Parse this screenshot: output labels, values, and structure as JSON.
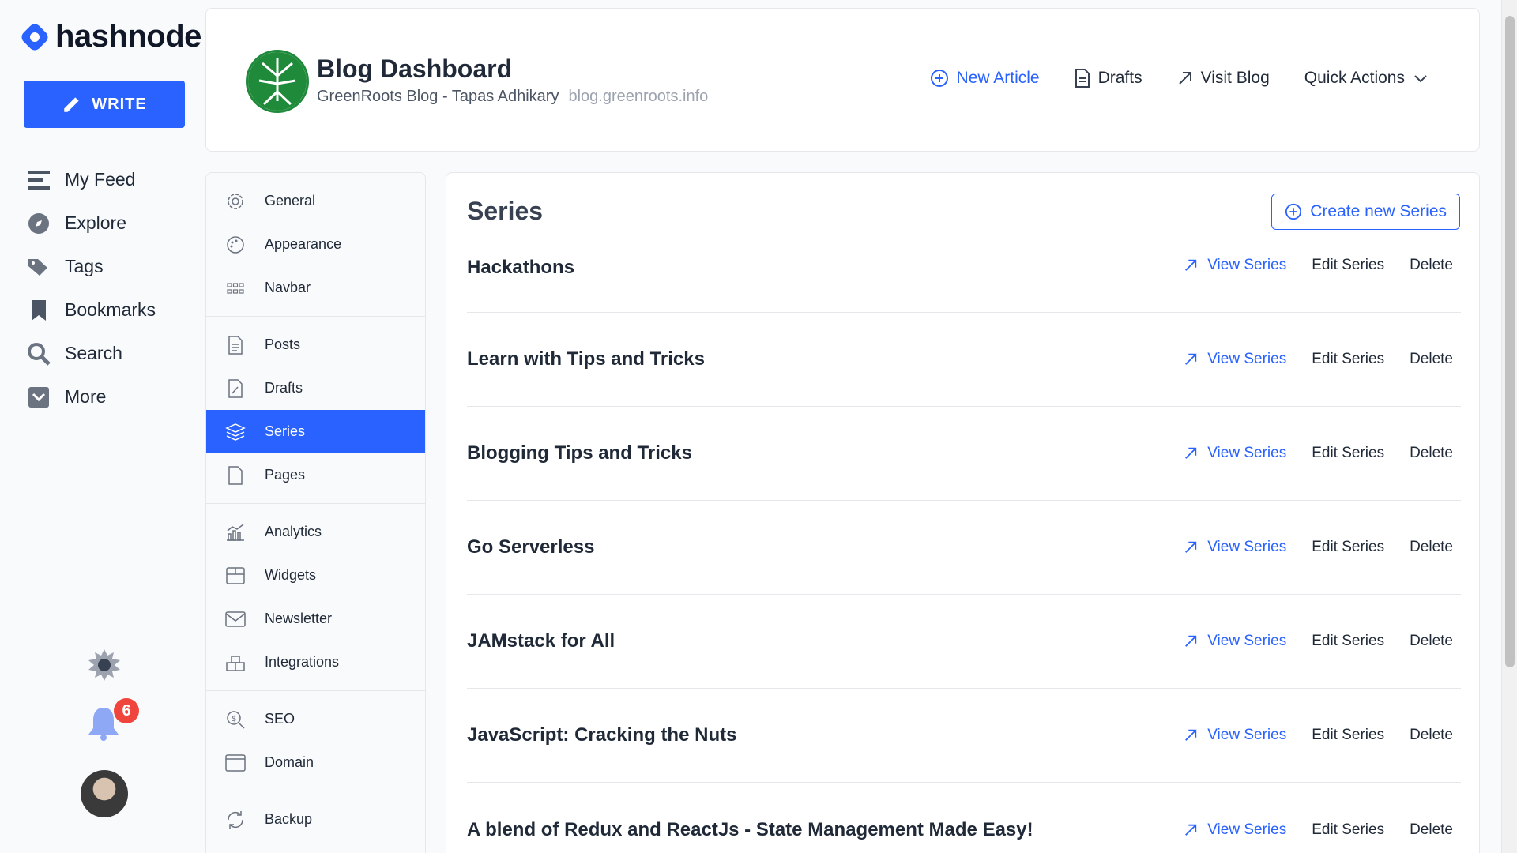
{
  "brand": {
    "name": "hashnode",
    "write_label": "WRITE"
  },
  "app_nav": [
    {
      "label": "My Feed",
      "icon": "feed-icon"
    },
    {
      "label": "Explore",
      "icon": "compass-icon"
    },
    {
      "label": "Tags",
      "icon": "tag-icon"
    },
    {
      "label": "Bookmarks",
      "icon": "bookmark-icon"
    },
    {
      "label": "Search",
      "icon": "search-icon"
    },
    {
      "label": "More",
      "icon": "chevron-down-icon"
    }
  ],
  "notifications": {
    "count": "6"
  },
  "header": {
    "title": "Blog Dashboard",
    "blog_name": "GreenRoots Blog - Tapas Adhikary",
    "domain": "blog.greenroots.info",
    "actions": {
      "new_article": "New Article",
      "drafts": "Drafts",
      "visit_blog": "Visit Blog",
      "quick_actions": "Quick Actions"
    }
  },
  "settings_nav": {
    "group1": [
      {
        "label": "General",
        "icon": "gear-icon"
      },
      {
        "label": "Appearance",
        "icon": "palette-icon"
      },
      {
        "label": "Navbar",
        "icon": "grid-icon"
      }
    ],
    "group2": [
      {
        "label": "Posts",
        "icon": "document-icon"
      },
      {
        "label": "Drafts",
        "icon": "draft-icon"
      },
      {
        "label": "Series",
        "icon": "layers-icon",
        "active": true
      },
      {
        "label": "Pages",
        "icon": "page-icon"
      }
    ],
    "group3": [
      {
        "label": "Analytics",
        "icon": "analytics-icon"
      },
      {
        "label": "Widgets",
        "icon": "widgets-icon"
      },
      {
        "label": "Newsletter",
        "icon": "mail-icon"
      },
      {
        "label": "Integrations",
        "icon": "integrations-icon"
      }
    ],
    "group4": [
      {
        "label": "SEO",
        "icon": "seo-icon"
      },
      {
        "label": "Domain",
        "icon": "domain-icon"
      }
    ],
    "group5": [
      {
        "label": "Backup",
        "icon": "backup-icon"
      }
    ]
  },
  "series_section": {
    "title": "Series",
    "create_label": "Create new Series",
    "view_label": "View Series",
    "edit_label": "Edit Series",
    "delete_label": "Delete",
    "items": [
      "Hackathons",
      "Learn with Tips and Tricks",
      "Blogging Tips and Tricks",
      "Go Serverless",
      "JAMstack for All",
      "JavaScript: Cracking the Nuts",
      "A blend of Redux and ReactJs - State Management Made Easy!"
    ]
  },
  "colors": {
    "accent": "#2962ff",
    "badge": "#f0453c",
    "brand_green": "#1e8a3a"
  }
}
